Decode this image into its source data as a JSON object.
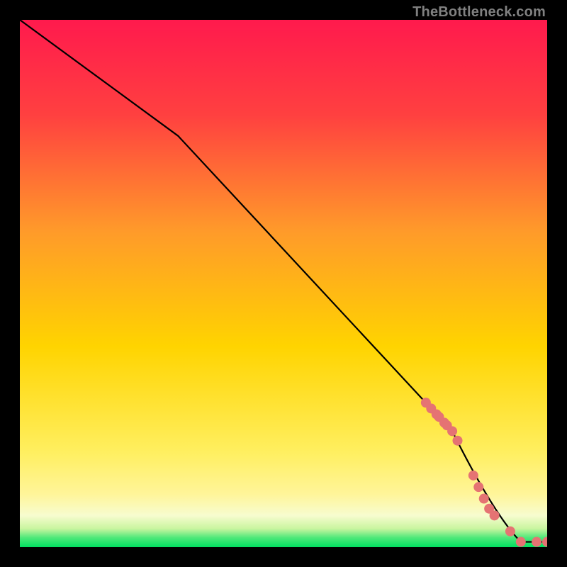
{
  "attribution": "TheBottleneck.com",
  "colors": {
    "bg_black": "#000000",
    "grad_top": "#ff1a4d",
    "grad_mid_upper": "#ff7a30",
    "grad_mid": "#ffd400",
    "grad_mid_lower": "#fff59a",
    "grad_pale": "#f7fccf",
    "grad_green": "#00e060",
    "curve": "#000000",
    "marker_fill": "#e57373",
    "marker_stroke": "#d46a6a"
  },
  "chart_data": {
    "type": "line",
    "title": "",
    "xlabel": "",
    "ylabel": "",
    "xlim": [
      0,
      100
    ],
    "ylim": [
      0,
      100
    ],
    "curve": {
      "x": [
        0,
        30,
        82,
        90,
        95,
        100
      ],
      "y": [
        100,
        78,
        22,
        6,
        1,
        1
      ],
      "note": "Black curve: steep segment 0–30, straight descent 30–82, easing 82–100 to flat tail"
    },
    "markers": {
      "x": [
        77,
        78,
        79,
        79.5,
        80.5,
        81,
        82,
        83,
        86,
        87,
        88,
        89,
        90,
        93,
        95,
        98,
        100
      ],
      "y": [
        27.4,
        26.3,
        25.2,
        24.7,
        23.6,
        23.1,
        22.0,
        20.2,
        13.6,
        11.4,
        9.2,
        7.3,
        6.0,
        3.0,
        1.0,
        1.0,
        1.0
      ],
      "note": "Salmon dots tracking the curve near the tail; values read off against 0–100 axes"
    }
  }
}
